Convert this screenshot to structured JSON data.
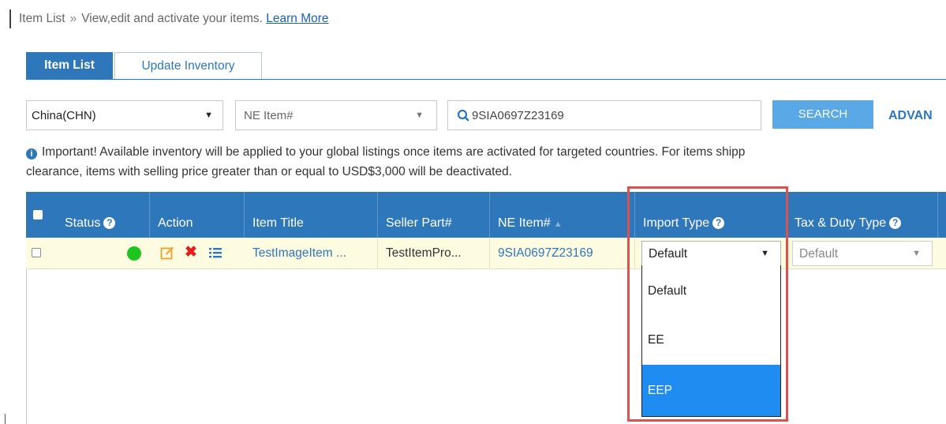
{
  "breadcrumb": {
    "title": "Item List",
    "separator": "»",
    "description": "View,edit and activate your items.",
    "learn_more": "Learn More"
  },
  "tabs": [
    {
      "label": "Item List",
      "active": true
    },
    {
      "label": "Update Inventory",
      "active": false
    }
  ],
  "filters": {
    "country": {
      "value": "China(CHN)",
      "icon": "caret-down-icon"
    },
    "id_type": {
      "value": "NE Item#",
      "icon": "caret-down-icon"
    },
    "search": {
      "value": "9SIA0697Z23169",
      "icon": "search-icon"
    },
    "search_button": "SEARCH",
    "advanced_link": "ADVAN"
  },
  "notice": {
    "line1": "Important! Available inventory will be applied to your global listings once items are activated for targeted countries. For items shipp",
    "line2": "clearance, items with selling price greater than or equal to USD$3,000 will be deactivated.",
    "icon": "info-icon"
  },
  "table": {
    "columns": [
      {
        "label": "Status",
        "help": true
      },
      {
        "label": "Action",
        "help": false
      },
      {
        "label": "Item Title",
        "help": false
      },
      {
        "label": "Seller Part#",
        "help": false
      },
      {
        "label": "NE Item#",
        "help": false,
        "sorted": true
      },
      {
        "label": "Import Type",
        "help": true
      },
      {
        "label": "Tax & Duty Type",
        "help": true
      }
    ],
    "help_glyph": "?",
    "sort_glyph": "▲",
    "rows": [
      {
        "status": "active",
        "status_color": "#1ec51e",
        "item_title": "TestImageItem ...",
        "seller_part": "TestItemPro...",
        "ne_item": "9SIA0697Z23169",
        "import_type": "Default",
        "tax_duty_type": "Default"
      }
    ]
  },
  "import_type_dropdown": {
    "options": [
      "Default",
      "EE",
      "EEP"
    ],
    "highlighted": "EEP"
  },
  "colors": {
    "header_blue": "#2e77bb",
    "row_yellow": "#fdfbe0",
    "search_button": "#5aa9e6",
    "highlight_red": "#d9534f",
    "option_selected": "#1e8cf0",
    "link_blue": "#2e77bb"
  }
}
